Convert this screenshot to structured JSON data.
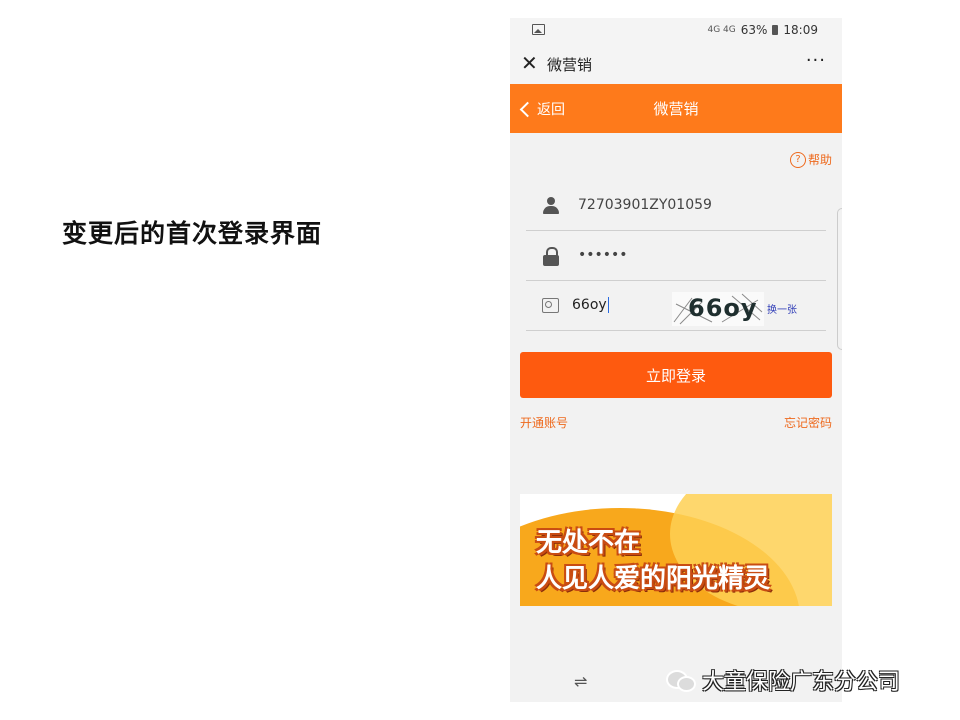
{
  "slide": {
    "caption": "变更后的首次登录界面"
  },
  "status_bar": {
    "signal_text": "4G 4G",
    "battery": "63%",
    "time": "18:09"
  },
  "wechat_bar": {
    "title": "微营销",
    "more_label": "···",
    "close_label": "✕"
  },
  "header": {
    "back_label": "返回",
    "title": "微营销"
  },
  "help_link": {
    "icon": "?",
    "label": "帮助"
  },
  "form": {
    "username": "72703901ZY01059",
    "password": "••••••",
    "captcha_input": "66oy",
    "captcha_image_text": "66oy",
    "refresh_captcha_label": "换一张"
  },
  "login_button": "立即登录",
  "links": {
    "register": "开通账号",
    "forgot_password": "忘记密码"
  },
  "banner": {
    "line1": "无处不在",
    "line2": "人见人爱的阳光精灵"
  },
  "nav": {
    "back_gesture": "⇌"
  },
  "watermark": {
    "text": "大童保险广东分公司"
  },
  "colors": {
    "header": "#fe7a1b",
    "button": "#fe5a0f",
    "link": "#ee6a1e"
  }
}
